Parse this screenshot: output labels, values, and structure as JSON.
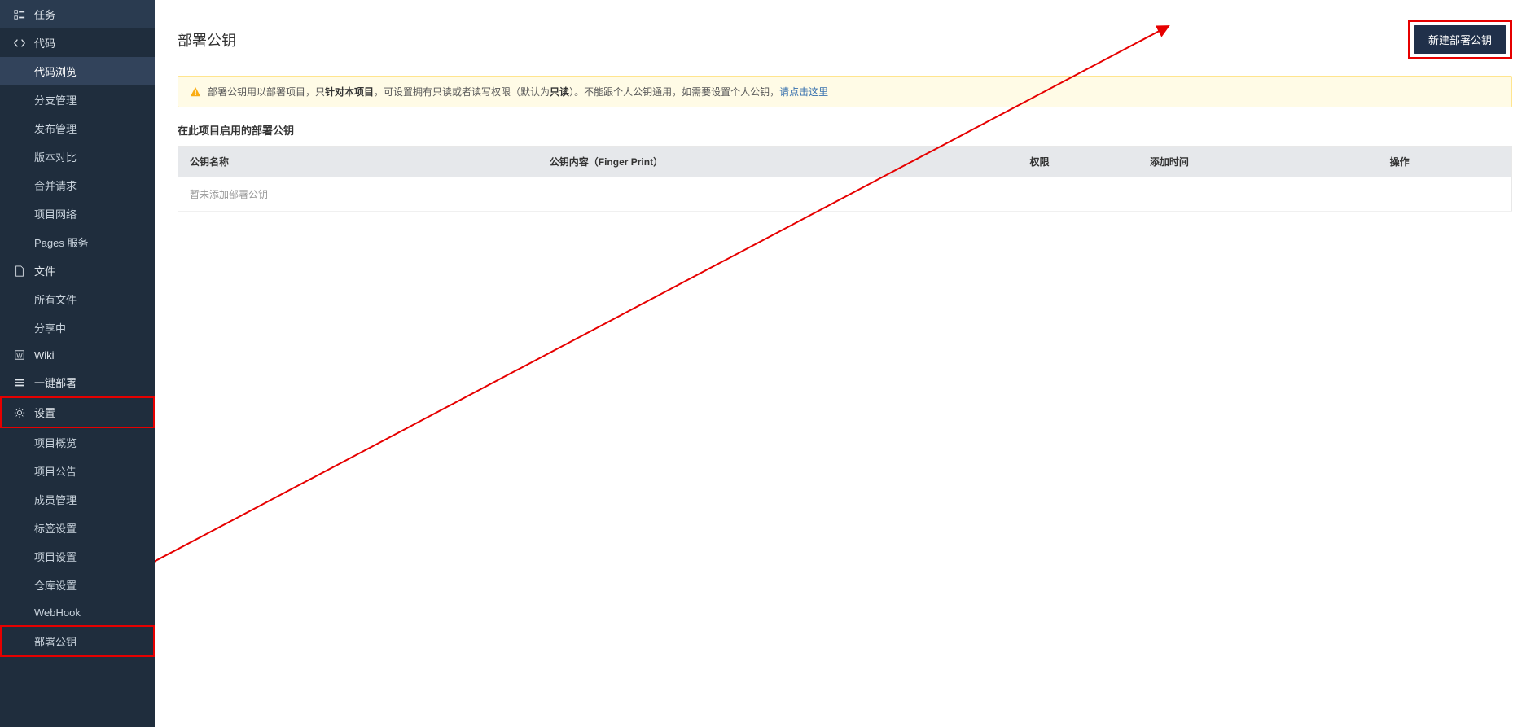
{
  "sidebar": {
    "groups": [
      {
        "label": "任务",
        "icon": "checklist"
      },
      {
        "label": "代码",
        "icon": "code",
        "children": [
          {
            "label": "代码浏览",
            "active": true
          },
          {
            "label": "分支管理"
          },
          {
            "label": "发布管理"
          },
          {
            "label": "版本对比"
          },
          {
            "label": "合并请求"
          },
          {
            "label": "项目网络"
          },
          {
            "label": "Pages 服务"
          }
        ]
      },
      {
        "label": "文件",
        "icon": "file",
        "children": [
          {
            "label": "所有文件"
          },
          {
            "label": "分享中"
          }
        ]
      },
      {
        "label": "Wiki",
        "icon": "wiki"
      },
      {
        "label": "一键部署",
        "icon": "deploy"
      },
      {
        "label": "设置",
        "icon": "gear",
        "highlight": true,
        "children": [
          {
            "label": "项目概览"
          },
          {
            "label": "项目公告"
          },
          {
            "label": "成员管理"
          },
          {
            "label": "标签设置"
          },
          {
            "label": "项目设置"
          },
          {
            "label": "仓库设置"
          },
          {
            "label": "WebHook"
          },
          {
            "label": "部署公钥",
            "highlight": true
          }
        ]
      }
    ]
  },
  "page": {
    "title": "部署公钥",
    "create_button": "新建部署公钥",
    "alert_prefix": "部署公钥用以部署项目，只",
    "alert_bold1": "针对本项目",
    "alert_mid": "，可设置拥有只读或者读写权限（默认为",
    "alert_bold2": "只读",
    "alert_tail": "）。不能跟个人公钥通用，如需要设置个人公钥，",
    "alert_link": "请点击这里",
    "section_title": "在此项目启用的部署公钥",
    "table_headers": {
      "name": "公钥名称",
      "content": "公钥内容（Finger Print）",
      "perm": "权限",
      "time": "添加时间",
      "action": "操作"
    },
    "empty_row": "暂未添加部署公钥"
  }
}
